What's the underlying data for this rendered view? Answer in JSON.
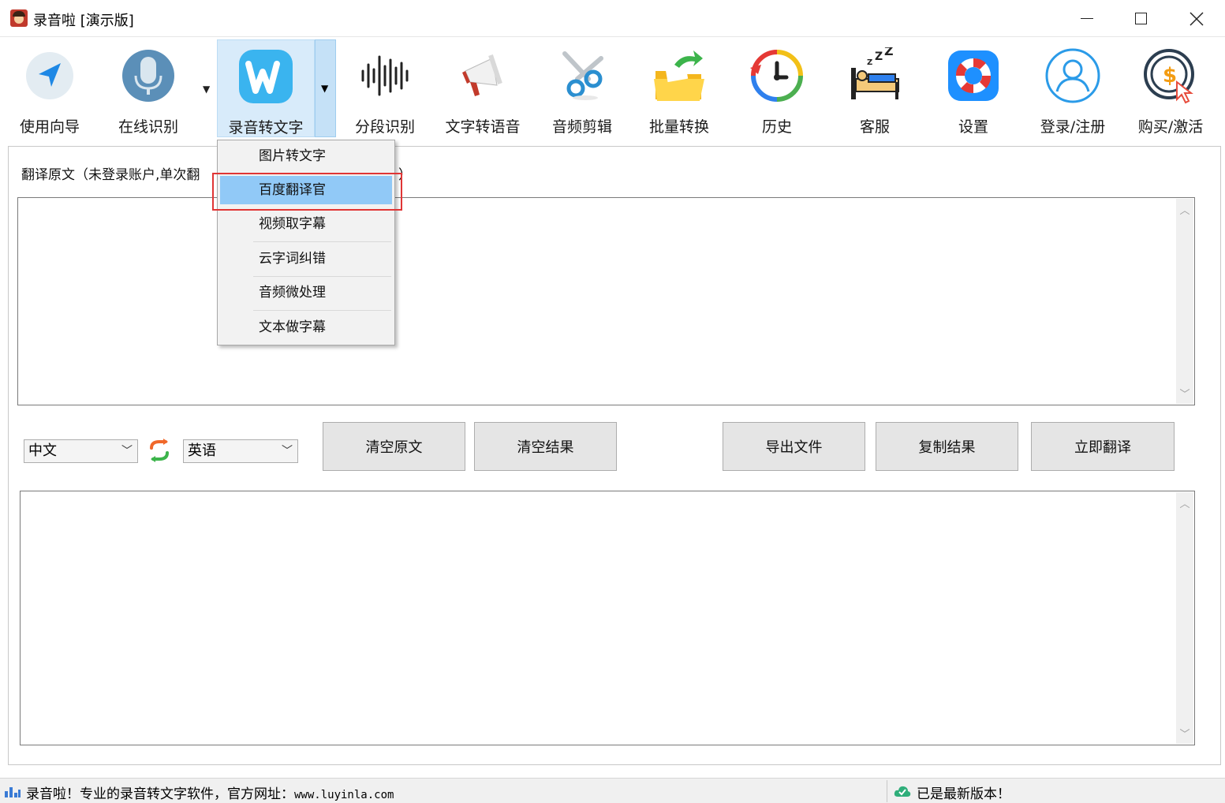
{
  "window": {
    "title": "录音啦 [演示版]"
  },
  "toolbar": {
    "items": [
      {
        "label": "使用向导",
        "icon": "navigation-arrow-icon"
      },
      {
        "label": "在线识别",
        "icon": "microphone-icon"
      },
      {
        "label": "录音转文字",
        "icon": "w-logo-icon"
      },
      {
        "label": "分段识别",
        "icon": "waveform-icon"
      },
      {
        "label": "文字转语音",
        "icon": "megaphone-icon"
      },
      {
        "label": "音频剪辑",
        "icon": "scissors-icon"
      },
      {
        "label": "批量转换",
        "icon": "folder-convert-icon"
      },
      {
        "label": "历史",
        "icon": "history-clock-icon"
      },
      {
        "label": "客服",
        "icon": "sleeping-bed-icon"
      },
      {
        "label": "设置",
        "icon": "lifebuoy-icon"
      },
      {
        "label": "登录/注册",
        "icon": "user-icon"
      },
      {
        "label": "购买/激活",
        "icon": "dollar-coin-icon"
      }
    ]
  },
  "menu": {
    "items": [
      "图片转文字",
      "百度翻译官",
      "视频取字幕",
      "云字词纠错",
      "音频微处理",
      "文本做字幕"
    ],
    "hovered": "百度翻译官"
  },
  "source": {
    "label_left": "翻译原文（未登录账户,单次翻",
    "label_right": "）",
    "text": ""
  },
  "language": {
    "from": "中文",
    "to": "英语"
  },
  "buttons": {
    "clear_source": "清空原文",
    "clear_result": "清空结果",
    "export_file": "导出文件",
    "copy_result": "复制结果",
    "translate_now": "立即翻译"
  },
  "result": {
    "text": ""
  },
  "status": {
    "left_text": "录音啦！专业的录音转文字软件，官方网址：",
    "url": "www.luyinla.com",
    "right_text": "已是最新版本！"
  },
  "colors": {
    "accent_hover": "#91c9f7",
    "active_tool": "#d8ebfa",
    "highlight_border": "#e03535"
  }
}
